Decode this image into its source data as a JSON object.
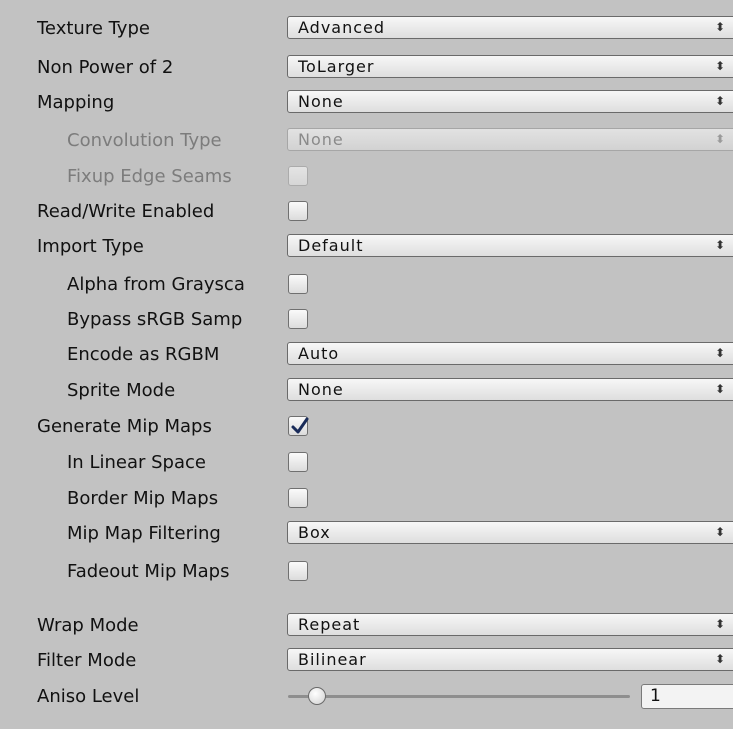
{
  "inspector": {
    "texture_type": {
      "label": "Texture Type",
      "value": "Advanced"
    },
    "non_power_of_2": {
      "label": "Non Power of 2",
      "value": "ToLarger"
    },
    "mapping": {
      "label": "Mapping",
      "value": "None"
    },
    "convolution_type": {
      "label": "Convolution Type",
      "value": "None"
    },
    "fixup_edge_seams": {
      "label": "Fixup Edge Seams",
      "checked": false
    },
    "read_write_enabled": {
      "label": "Read/Write Enabled",
      "checked": false
    },
    "import_type": {
      "label": "Import Type",
      "value": "Default"
    },
    "alpha_from_grayscale": {
      "label": "Alpha from Graysca",
      "checked": false
    },
    "bypass_srgb": {
      "label": "Bypass sRGB Samp",
      "checked": false
    },
    "encode_as_rgbm": {
      "label": "Encode as RGBM",
      "value": "Auto"
    },
    "sprite_mode": {
      "label": "Sprite Mode",
      "value": "None"
    },
    "generate_mip_maps": {
      "label": "Generate Mip Maps",
      "checked": true
    },
    "in_linear_space": {
      "label": "In Linear Space",
      "checked": false
    },
    "border_mip_maps": {
      "label": "Border Mip Maps",
      "checked": false
    },
    "mip_map_filtering": {
      "label": "Mip Map Filtering",
      "value": "Box"
    },
    "fadeout_mip_maps": {
      "label": "Fadeout Mip Maps",
      "checked": false
    },
    "wrap_mode": {
      "label": "Wrap Mode",
      "value": "Repeat"
    },
    "filter_mode": {
      "label": "Filter Mode",
      "value": "Bilinear"
    },
    "aniso_level": {
      "label": "Aniso Level",
      "value": "1"
    }
  },
  "icons": {
    "dropdown_arrow": "updown-arrow-icon",
    "checkmark": "checkmark-icon"
  }
}
